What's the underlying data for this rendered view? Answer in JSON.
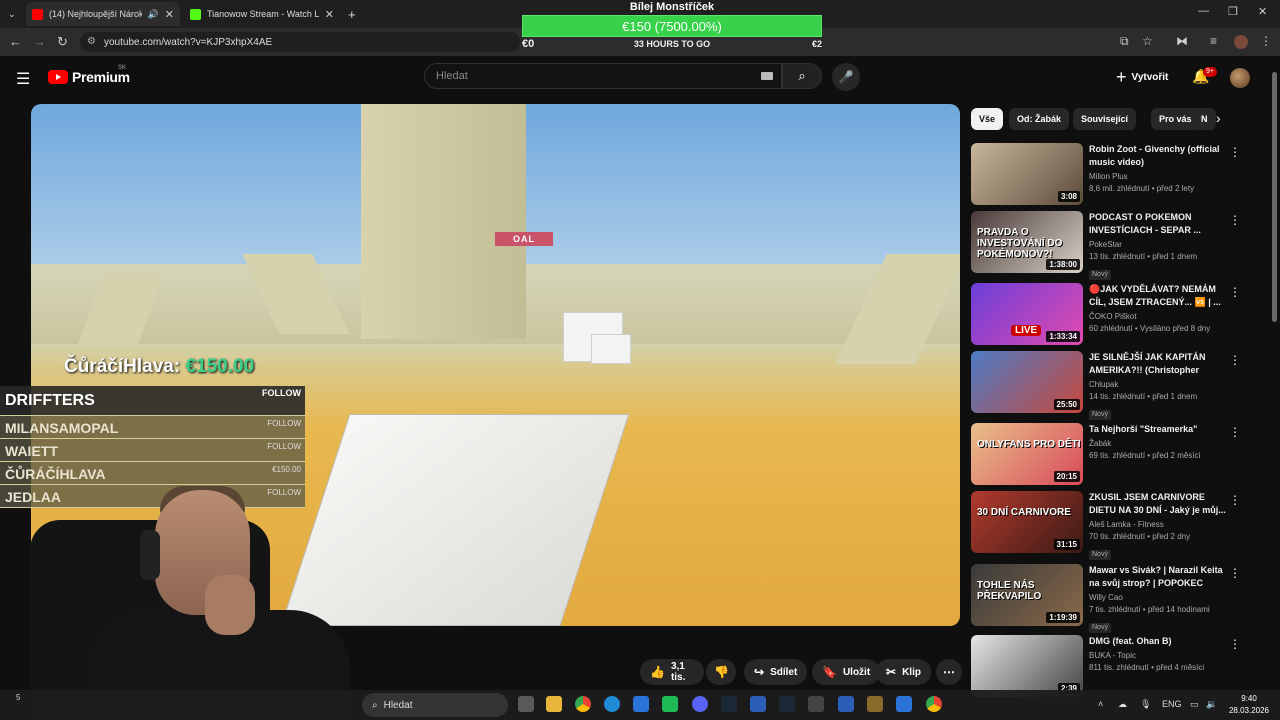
{
  "browser": {
    "tabs": [
      {
        "title": "(14) Nejhloupější Nároky na..."
      },
      {
        "title": "Tianowow Stream - Watch Live..."
      }
    ],
    "new_tab": "+",
    "url": "youtube.com/watch?v=KJP3xhpX4AE"
  },
  "donation_goal": {
    "name": "Bílej Monstříček",
    "bar_text": "€150 (7500.00%)",
    "progress_fraction": 1.0,
    "min": "€0",
    "time_left": "33 HOURS TO GO",
    "goal": "€2"
  },
  "youtube": {
    "brand": "Premium",
    "country": "SK",
    "search_placeholder": "Hledat",
    "create_label": "Vytvořit",
    "notif_count": "9+"
  },
  "stream_overlay": {
    "donor_name": "ČůráčíHlava:",
    "donor_amount": "€150.00",
    "follow_header": {
      "name": "DRIFFTERS",
      "tag": "FOLLOW"
    },
    "follow_rows": [
      {
        "name": "MILANSAMOPAL",
        "tag": "FOLLOW"
      },
      {
        "name": "WAIETT",
        "tag": "FOLLOW"
      },
      {
        "name": "ČŮRÁČÍHLAVA",
        "tag": "€150.00"
      },
      {
        "name": "JEDLAA",
        "tag": "FOLLOW"
      }
    ],
    "video_sign": "OAL"
  },
  "actions": {
    "likes": "3,1 tis.",
    "share": "Sdílet",
    "save": "Uložit",
    "clip": "Klip"
  },
  "chips": [
    "Vše",
    "Od: Žabák",
    "Související",
    "Pro vás",
    "N"
  ],
  "recommendations": [
    {
      "title": "Robin Zoot - Givenchy (official music video)",
      "channel": "Milion Plus",
      "meta": "8,6 mil. zhlédnutí • před 2 lety",
      "duration": "3:08",
      "new": "",
      "thumb_text": "",
      "colors": [
        "#c9b79c",
        "#5b4b3a"
      ]
    },
    {
      "title": "PODCAST O POKEMON INVESTÍCIACH - SEPAR ...",
      "channel": "PokeStar",
      "meta": "13 tis. zhlédnutí • před 1 dnem",
      "duration": "1:38:00",
      "new": "Nový",
      "thumb_text": "PRAVDA O INVESTOVÁNÍ DO POKÉMONOV?!",
      "colors": [
        "#4a3a3a",
        "#d8d2c6"
      ]
    },
    {
      "title": "🔴JAK VYDĚLÁVAT? NEMÁM CÍL, JSEM ZTRACENÝ... 🆚 | ...",
      "channel": "ČOKO Piškot",
      "meta": "60 zhlédnutí • Vysíláno před 8 dny",
      "duration": "1:33:34",
      "new": "",
      "thumb_text": "",
      "live": "LIVE",
      "colors": [
        "#6a3fd8",
        "#e34ab0"
      ]
    },
    {
      "title": "JE SILNĚJŠÍ JAK KAPITÁN AMERIKA?!! (Christopher Dorn...",
      "channel": "Chlupak",
      "meta": "14 tis. zhlédnutí • před 1 dnem",
      "duration": "25:50",
      "new": "Nový",
      "thumb_text": "",
      "colors": [
        "#4d7cc6",
        "#c7483c"
      ]
    },
    {
      "title": "Ta Nejhorší \"Streamerka\"",
      "channel": "Žabák",
      "meta": "69 tis. zhlédnutí • před 2 měsíci",
      "duration": "20:15",
      "new": "",
      "thumb_text": "ONLYFANS PRO DĚTI",
      "colors": [
        "#e8c08a",
        "#d94a5a"
      ]
    },
    {
      "title": "ZKUSIL JSEM CARNIVORE DIETU NA 30 DNÍ - Jaký je můj...",
      "channel": "Aleš Lamka - Fitness",
      "meta": "70 tis. zhlédnutí • před 2 dny",
      "duration": "31:15",
      "new": "Nový",
      "thumb_text": "30 DNÍ CARNIVORE",
      "colors": [
        "#b23a2e",
        "#3a1a14"
      ]
    },
    {
      "title": "Mawar vs Sivák? | Narazil Keita na svůj strop? | POPOKEC",
      "channel": "Willy Cao",
      "meta": "7 tis. zhlédnutí • před 14 hodinami",
      "duration": "1:19:39",
      "new": "Nový",
      "thumb_text": "TOHLE NÁS PŘEKVAPILO",
      "colors": [
        "#3a3a3a",
        "#8a6a4a"
      ]
    },
    {
      "title": "DMG (feat. Ohan B)",
      "channel": "BUKA - Topic",
      "meta": "811 tis. zhlédnutí • před 4 měsíci",
      "duration": "2:39",
      "new": "",
      "thumb_text": "",
      "colors": [
        "#e6e6e6",
        "#444444"
      ]
    }
  ],
  "taskbar": {
    "search_label": "Hledat",
    "lang": "ENG",
    "time": "9:40",
    "date": "28.03.2026",
    "left_notif": "5"
  }
}
